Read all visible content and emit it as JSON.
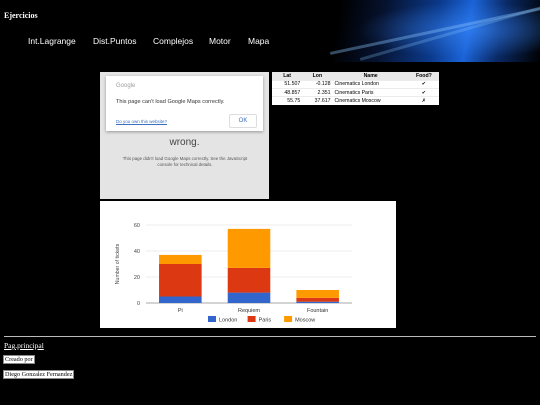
{
  "header": {
    "title": "Ejercicios",
    "nav": [
      "Int.Lagrange",
      "Dist.Puntos",
      "Complejos",
      "Motor",
      "Mapa"
    ]
  },
  "map_error": {
    "brand": "Google",
    "message": "This page can't load Google Maps correctly.",
    "link": "Do you own this website?",
    "ok_label": "OK",
    "partial_word": "wrong.",
    "sub_message": "This page didn't load Google Maps correctly. See the JavaScript console for technical details."
  },
  "table": {
    "headers": [
      "Lat",
      "Lon",
      "Name",
      "Food?"
    ],
    "rows": [
      [
        "51.507",
        "-0.128",
        "Cinematics London",
        "✔"
      ],
      [
        "48.857",
        "2.351",
        "Cinematics Paris",
        "✔"
      ],
      [
        "55.75",
        "37.617",
        "Cinematics Moscow",
        "✗"
      ]
    ]
  },
  "chart_data": {
    "type": "bar",
    "stacked": true,
    "categories": [
      "Pi",
      "Requiem",
      "Fountain"
    ],
    "series": [
      {
        "name": "London",
        "values": [
          5,
          8,
          1
        ],
        "color": "#3366cc"
      },
      {
        "name": "Paris",
        "values": [
          25,
          19,
          3
        ],
        "color": "#dc3912"
      },
      {
        "name": "Moscow",
        "values": [
          7,
          30,
          6
        ],
        "color": "#ff9900"
      }
    ],
    "ylabel": "Number of tickets",
    "ylim": [
      0,
      60
    ],
    "yticks": [
      "0",
      "20",
      "40",
      "60"
    ],
    "grid": true,
    "legend": "bottom"
  },
  "footer": {
    "link": "Pag.principal",
    "created_label": "Creado por",
    "author": "Diego Gonzalez Fernandez"
  }
}
